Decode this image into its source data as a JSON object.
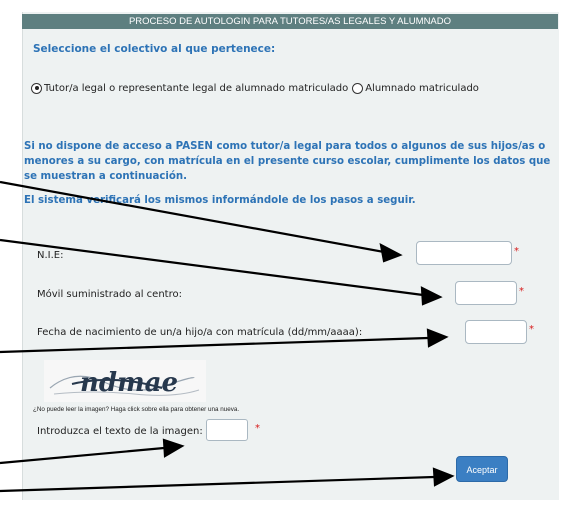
{
  "header": {
    "title": "PROCESO DE AUTOLOGIN PARA TUTORES/AS LEGALES Y ALUMNADO"
  },
  "collective": {
    "title": "Seleccione el colectivo al que pertenece:",
    "options": [
      {
        "label": "Tutor/a legal o representante legal de alumnado matriculado",
        "selected": true
      },
      {
        "label": "Alumnado matriculado",
        "selected": false
      }
    ]
  },
  "info": {
    "text": "Si no dispone de acceso a PASEN como tutor/a legal para todos o algunos de sus hijos/as o menores a su cargo, con matrícula en el presente curso escolar, cumplimente los datos que se muestran a continuación.",
    "verify": "El sistema verificará los mismos informándole de los pasos a seguir."
  },
  "form": {
    "nie_label": "N.I.E:",
    "mobile_label": "Móvil suministrado al centro:",
    "birthdate_label": "Fecha de nacimiento de un/a hijo/a con matrícula (dd/mm/aaaa):",
    "required_mark": "*"
  },
  "captcha": {
    "image_text": "ndmae",
    "help": "¿No puede leer la imagen? Haga click sobre ella para obtener una nueva.",
    "input_label": "Introduzca el texto de la imagen:"
  },
  "submit": {
    "label": "Aceptar"
  },
  "colors": {
    "header": "#5e7f80",
    "accent": "#2d73b6",
    "button": "#3b7fc3",
    "required": "#d61a1a"
  }
}
